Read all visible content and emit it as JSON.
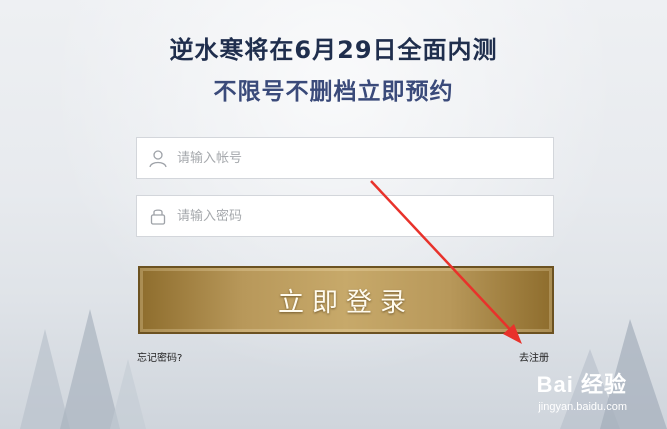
{
  "headline": {
    "line1": "逆水寒将在6月29日全面内测",
    "line2": "不限号不删档立即预约"
  },
  "login_form": {
    "username_placeholder": "请输入帐号",
    "password_placeholder": "请输入密码",
    "submit_label": "立即登录",
    "forgot_label": "忘记密码?",
    "register_label": "去注册"
  },
  "watermark": {
    "logo": "Bai 经验",
    "url": "jingyan.baidu.com"
  },
  "colors": {
    "headline": "#1f2e4d",
    "button_gold": "#b8985a",
    "arrow": "#e8322b"
  },
  "icons": [
    "user-icon",
    "lock-icon",
    "red-arrow"
  ]
}
